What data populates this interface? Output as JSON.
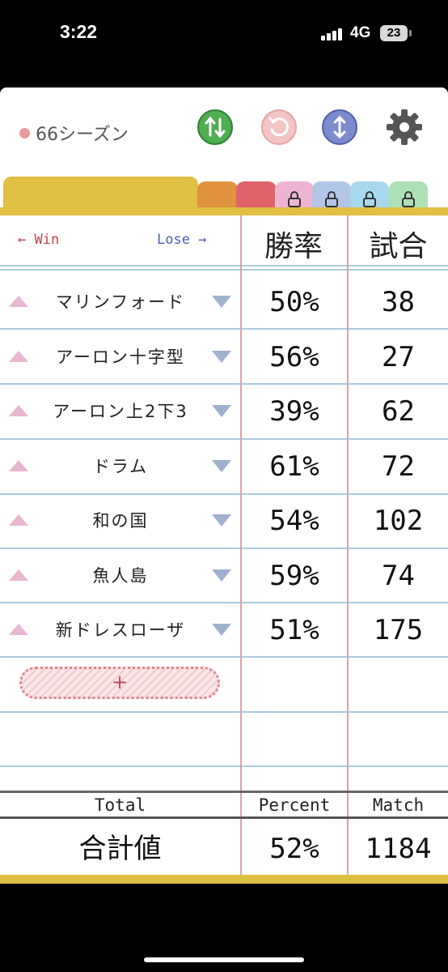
{
  "status": {
    "time": "3:22",
    "network": "4G",
    "battery": "23"
  },
  "header": {
    "season": "66シーズン",
    "icons": [
      "swap-vertical-icon",
      "undo-icon",
      "sort-icon",
      "gear-icon"
    ],
    "colors": {
      "green": "#4fae52",
      "pink": "#e9a6a6",
      "blue": "#5d6fba",
      "gray": "#555555"
    }
  },
  "tabs": [
    {
      "color": "#dfbf44",
      "locked": false
    },
    {
      "color": "#e0923f",
      "locked": false
    },
    {
      "color": "#e0626a",
      "locked": false
    },
    {
      "color": "#eeb4d3",
      "locked": true
    },
    {
      "color": "#b3c6e8",
      "locked": true
    },
    {
      "color": "#a7d8eb",
      "locked": true
    },
    {
      "color": "#aee0b5",
      "locked": true
    }
  ],
  "table": {
    "win_label": "← Win",
    "lose_label": "Lose →",
    "col_percent": "勝率",
    "col_match": "試合",
    "rows": [
      {
        "name": "マリンフォード",
        "percent": "50%",
        "match": "38"
      },
      {
        "name": "アーロン十字型",
        "percent": "56%",
        "match": "27"
      },
      {
        "name": "アーロン上2下3",
        "percent": "39%",
        "match": "62"
      },
      {
        "name": "ドラム",
        "percent": "61%",
        "match": "72"
      },
      {
        "name": "和の国",
        "percent": "54%",
        "match": "102"
      },
      {
        "name": "魚人島",
        "percent": "59%",
        "match": "74"
      },
      {
        "name": "新ドレスローザ",
        "percent": "51%",
        "match": "175"
      }
    ],
    "add_label": "+"
  },
  "footer": {
    "total_label": "Total",
    "percent_label": "Percent",
    "match_label": "Match",
    "total_value": "合計値",
    "percent_value": "52%",
    "match_value": "1184"
  }
}
